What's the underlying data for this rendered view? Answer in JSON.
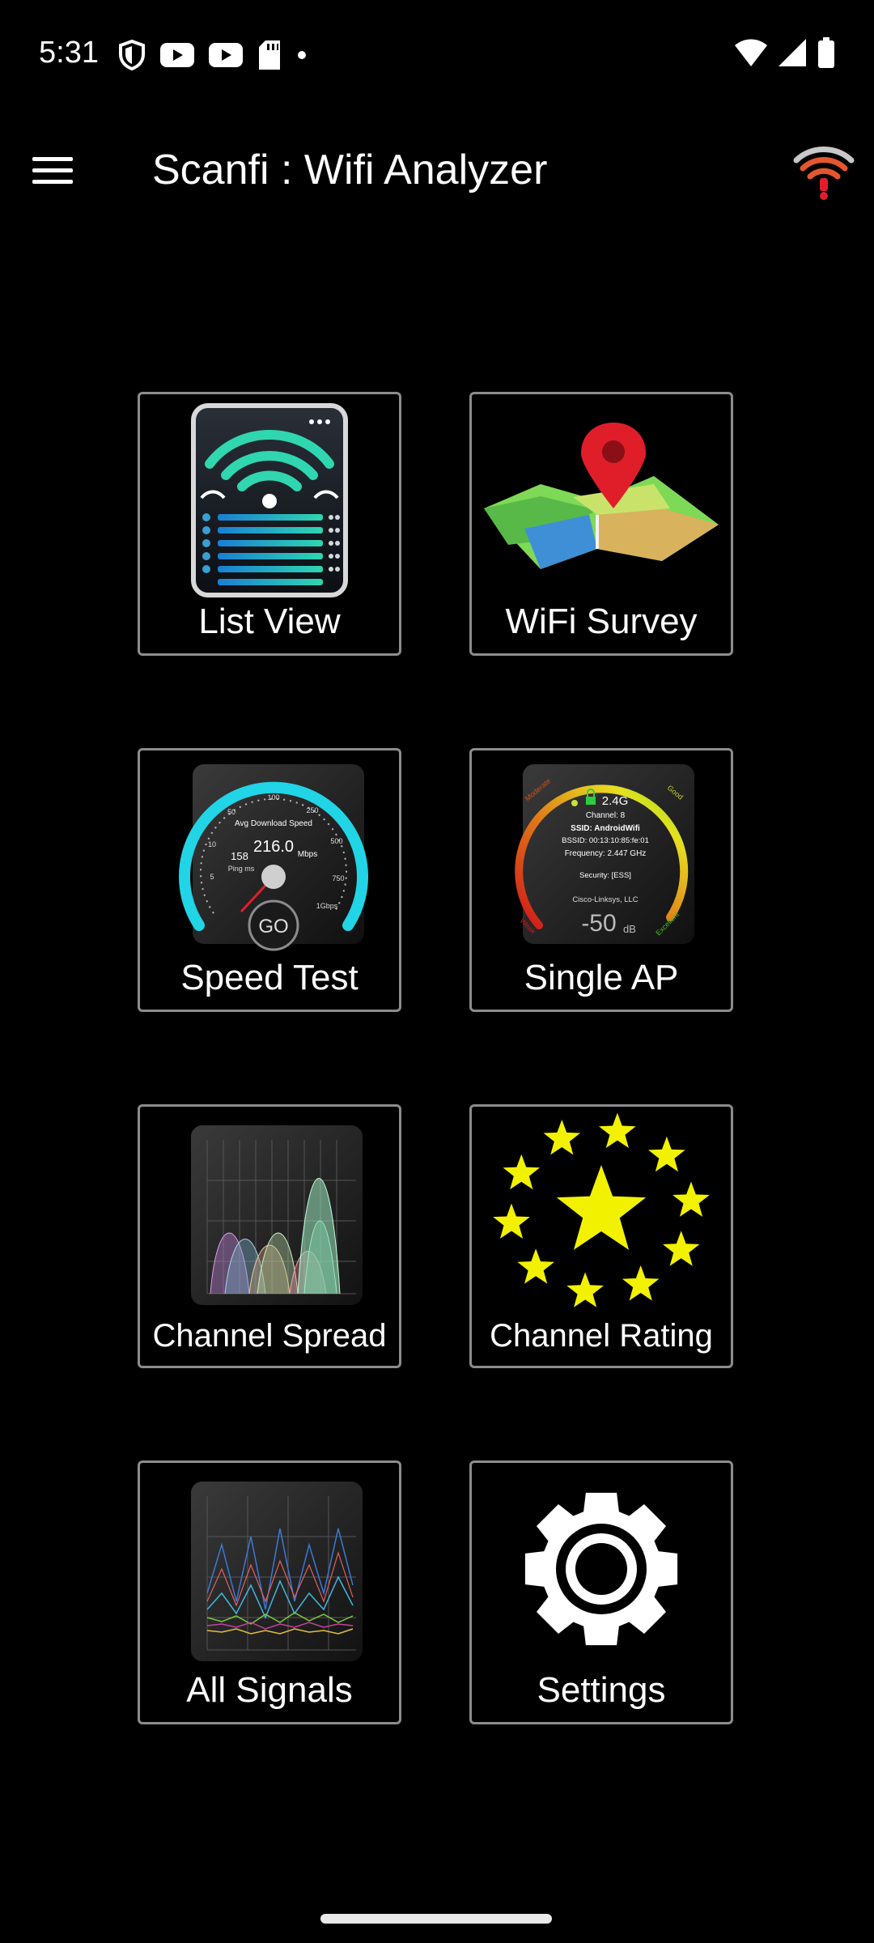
{
  "status_bar": {
    "time": "5:31",
    "left_icons": [
      "shield-icon",
      "youtube-icon",
      "youtube-icon",
      "sd-card-icon",
      "dot-icon"
    ],
    "right_icons": [
      "wifi-icon",
      "cell-signal-icon",
      "battery-icon"
    ]
  },
  "app_bar": {
    "title": "Scanfi : Wifi Analyzer",
    "menu_icon": "hamburger-icon",
    "logo_icon": "wifi-logo-icon"
  },
  "tiles": [
    {
      "label": "List View",
      "icon": "wifi-list-icon"
    },
    {
      "label": "WiFi Survey",
      "icon": "map-pin-icon"
    },
    {
      "label": "Speed Test",
      "icon": "speedometer-icon",
      "gauge": {
        "value": "216.0",
        "caption": "Avg Download Speed",
        "unit": "Mbps",
        "ping_label": "Ping ms",
        "ping": "158",
        "go": "GO",
        "ticks": [
          "5",
          "10",
          "50",
          "100",
          "250",
          "500",
          "750",
          "1Gbps"
        ]
      }
    },
    {
      "label": "Single AP",
      "icon": "signal-gauge-icon",
      "ap": {
        "band": "2.4G",
        "channel": "Channel: 8",
        "ssid": "SSID: AndroidWifi",
        "bssid": "BSSID: 00:13:10:85:fe:01",
        "frequency": "Frequency: 2.447 GHz",
        "security": "Security: [ESS]",
        "vendor": "Cisco-Linksys, LLC",
        "db": "-50",
        "db_unit": "dB",
        "quality": [
          "Weak",
          "Moderate",
          "Good",
          "Excellent"
        ]
      }
    },
    {
      "label": "Channel Spread",
      "icon": "channel-spread-chart-icon"
    },
    {
      "label": "Channel Rating",
      "icon": "stars-icon"
    },
    {
      "label": "All Signals",
      "icon": "signal-lines-chart-icon"
    },
    {
      "label": "Settings",
      "icon": "gear-icon"
    }
  ],
  "colors": {
    "background": "#000000",
    "tile_border": "#8c8c8c",
    "accent_cyan": "#21d4e6",
    "star_yellow": "#f2f200"
  }
}
